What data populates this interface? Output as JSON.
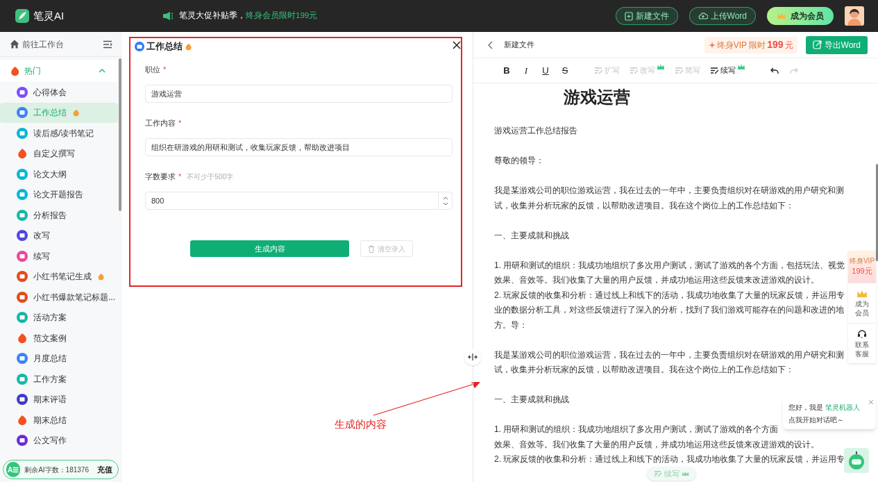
{
  "header": {
    "brand": "笔灵AI",
    "promo": "笔灵大促补贴季，",
    "promo_highlight": "终身会员限时199元",
    "buttons": [
      {
        "label": "新建文件",
        "kind": "file"
      },
      {
        "label": "上传Word",
        "kind": "cloud"
      },
      {
        "label": "成为会员",
        "kind": "vip"
      }
    ]
  },
  "sidebar": {
    "workbench": "前往工作台",
    "section": {
      "label": "热门",
      "expanded": true
    },
    "items": [
      {
        "label": "心得体会",
        "kind": "circle",
        "color": "#7c4dff",
        "hot": false,
        "selected": false
      },
      {
        "label": "工作总结",
        "kind": "circle",
        "color": "#3b82f6",
        "hot": true,
        "selected": true
      },
      {
        "label": "读后感/读书笔记",
        "kind": "circle",
        "color": "#06b6d4",
        "hot": false,
        "selected": false
      },
      {
        "label": "自定义撰写",
        "kind": "flame",
        "color": "#f4511e",
        "hot": false,
        "selected": false
      },
      {
        "label": "论文大纲",
        "kind": "circle",
        "color": "#06b6d4",
        "hot": false,
        "selected": false
      },
      {
        "label": "论文开题报告",
        "kind": "circle",
        "color": "#06b6d4",
        "hot": false,
        "selected": false
      },
      {
        "label": "分析报告",
        "kind": "circle",
        "color": "#14b8a6",
        "hot": false,
        "selected": false
      },
      {
        "label": "改写",
        "kind": "circle",
        "color": "#4f46e5",
        "hot": false,
        "selected": false
      },
      {
        "label": "续写",
        "kind": "circle",
        "color": "#ec4899",
        "hot": false,
        "selected": false
      },
      {
        "label": "小红书笔记生成",
        "kind": "circle",
        "color": "#e64a19",
        "hot": true,
        "selected": false
      },
      {
        "label": "小红书爆款笔记标题...",
        "kind": "circle",
        "color": "#e64a19",
        "hot": false,
        "selected": false
      },
      {
        "label": "活动方案",
        "kind": "circle",
        "color": "#14b8a6",
        "hot": false,
        "selected": false
      },
      {
        "label": "范文案例",
        "kind": "flame",
        "color": "#f4511e",
        "hot": false,
        "selected": false
      },
      {
        "label": "月度总结",
        "kind": "circle",
        "color": "#3b82f6",
        "hot": false,
        "selected": false
      },
      {
        "label": "工作方案",
        "kind": "circle",
        "color": "#14b8a6",
        "hot": false,
        "selected": false
      },
      {
        "label": "期末评语",
        "kind": "circle",
        "color": "#4338ca",
        "hot": false,
        "selected": false
      },
      {
        "label": "期末总结",
        "kind": "flame",
        "color": "#f4511e",
        "hot": false,
        "selected": false
      },
      {
        "label": "公文写作",
        "kind": "circle",
        "color": "#6d28d9",
        "hot": false,
        "selected": false
      }
    ],
    "credits": {
      "avatar": "A☰",
      "label": "剩余AI字数：181376",
      "action": "充值"
    }
  },
  "form": {
    "title": "工作总结",
    "fields": [
      {
        "label": "职位",
        "required": true,
        "value": "游戏运营",
        "kind": "text"
      },
      {
        "label": "工作内容",
        "required": true,
        "value": "组织在研游戏的用研和测试，收集玩家反馈，帮助改进项目",
        "kind": "text"
      },
      {
        "label": "字数要求",
        "required": true,
        "hint": "不可少于500字",
        "value": "800",
        "kind": "number"
      }
    ],
    "required_mark": "*",
    "submit": "生成内容",
    "clear": "清空录入"
  },
  "annotation": {
    "label": "生成的内容"
  },
  "editor": {
    "back_label": "新建文件",
    "vip": {
      "label": "终身VIP 限时 ",
      "price": "199",
      "unit": "元"
    },
    "export": "导出Word",
    "format": [
      "B",
      "I",
      "U",
      "S"
    ],
    "tools": [
      {
        "label": "扩写",
        "disabled": true,
        "crown": false
      },
      {
        "label": "改写",
        "disabled": true,
        "crown": true
      },
      {
        "label": "简写",
        "disabled": true,
        "crown": false
      },
      {
        "label": "续写",
        "disabled": false,
        "crown": true
      }
    ],
    "undo_disabled": false,
    "redo_disabled": true,
    "title": "游戏运营",
    "blocks": [
      [
        "游戏运营工作总结报告"
      ],
      [
        "尊敬的领导："
      ],
      [
        "我是某游戏公司的职位游戏运营，我在过去的一年中，主要负责组织对在研游戏的用户研究和测",
        "试，收集并分析玩家的反馈，以帮助改进项目。我在这个岗位上的工作总结如下："
      ],
      [
        "一、主要成就和挑战"
      ],
      [
        "1. 用研和测试的组织：我成功地组织了多次用户测试，测试了游戏的各个方面，包括玩法、视觉",
        "效果、音效等。我们收集了大量的用户反馈，并成功地运用这些反馈来改进游戏的设计。",
        "2. 玩家反馈的收集和分析：通过线上和线下的活动，我成功地收集了大量的玩家反馈，并运用专",
        "业的数据分析工具，对这些反馈进行了深入的分析，找到了我们游戏可能存在的问题和改进的地",
        "方。导："
      ],
      [
        "我是某游戏公司的职位游戏运营，我在过去的一年中，主要负责组织对在研游戏的用户研究和测",
        "试，收集并分析玩家的反馈，以帮助改进项目。我在这个岗位上的工作总结如下："
      ],
      [
        "一、主要成就和挑战"
      ],
      [
        "1. 用研和测试的组织：我成功地组织了多次用户测试，测试了游戏的各个方面",
        "效果、音效等。我们收集了大量的用户反馈，并成功地运用这些反馈来改进游戏的设计。",
        "2. 玩家反馈的收集和分析：通过线上和线下的活动，我成功地收集了大量的玩家反馈，并运用专"
      ]
    ],
    "float_tool": "续写"
  },
  "side_widgets": {
    "vip": {
      "label": "终身VIP",
      "price": "199元"
    },
    "items": [
      {
        "label": "成为会员",
        "kind": "crown"
      },
      {
        "label": "联系客服",
        "kind": "headset"
      }
    ]
  },
  "chat": {
    "greeting": "您好，我是 ",
    "bot": "笔灵机器人",
    "prompt": "点我开始对话吧～"
  }
}
